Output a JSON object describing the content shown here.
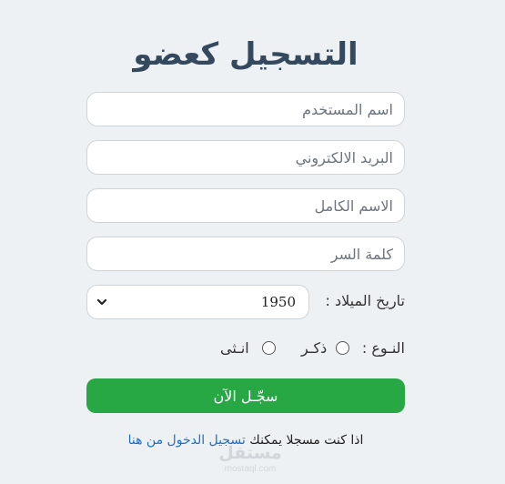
{
  "form": {
    "title": "التسجيل كعضو",
    "fields": {
      "username": {
        "placeholder": "اسم المستخدم",
        "value": ""
      },
      "email": {
        "placeholder": "البريد الالكتروني",
        "value": ""
      },
      "fullname": {
        "placeholder": "الاسم الكامل",
        "value": ""
      },
      "password": {
        "placeholder": "كلمة السر",
        "value": ""
      }
    },
    "birthdate": {
      "label": "تاريخ الميلاد :",
      "selected": "1950"
    },
    "gender": {
      "label": "النـوع :",
      "options": [
        "ذكـر",
        "انـثى"
      ]
    },
    "submit_label": "سجّـل الآن",
    "login_prompt": "اذا كنت مسجلا يمكنك",
    "login_link": "تسجيل الدخول من هنا"
  },
  "watermark": {
    "logo": "مستقل",
    "url": "mostaql.com"
  },
  "icons": {
    "select_chevron": "chevron-down-icon"
  }
}
